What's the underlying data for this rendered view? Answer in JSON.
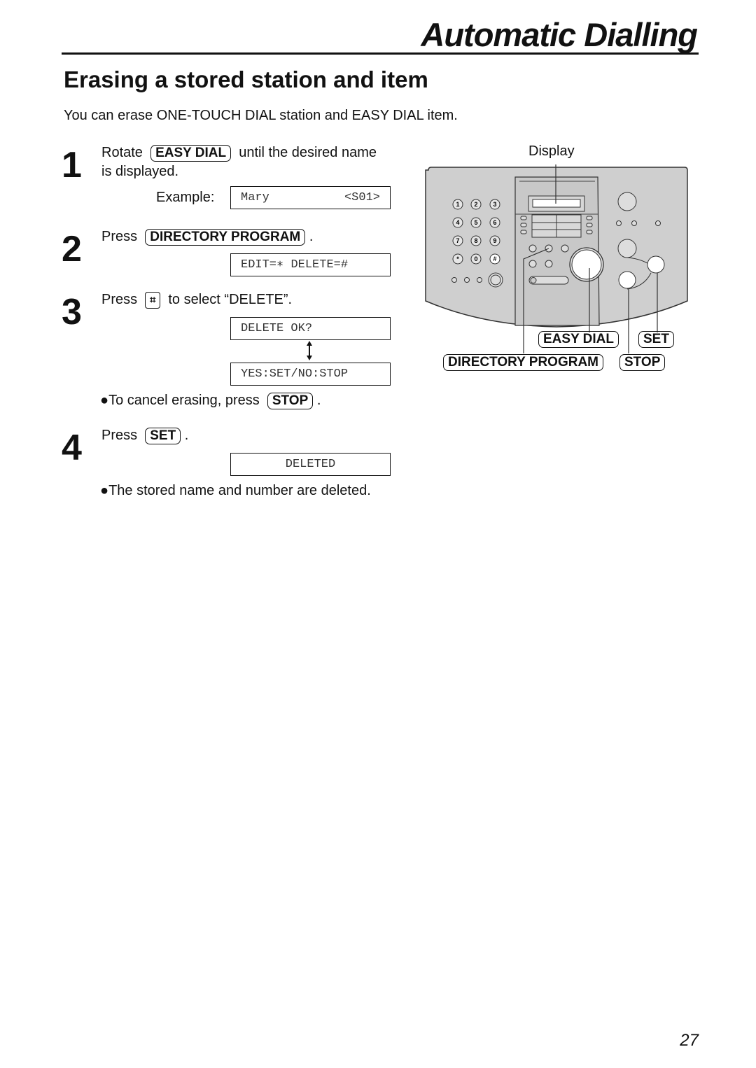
{
  "header": {
    "chapter_title": "Automatic Dialling"
  },
  "section": {
    "title": "Erasing a stored station and item",
    "intro": "You can erase ONE-TOUCH DIAL station and EASY DIAL item."
  },
  "steps": [
    {
      "number": "1",
      "prefix": "Rotate",
      "key": "EASY DIAL",
      "suffix_line1": "until the desired name",
      "suffix_line2": "is displayed.",
      "example_label": "Example:",
      "display_left": "Mary",
      "display_right": "<S01>"
    },
    {
      "number": "2",
      "prefix": "Press",
      "key": "DIRECTORY PROGRAM",
      "suffix": ".",
      "display": "EDIT=∗ DELETE=#"
    },
    {
      "number": "3",
      "prefix": "Press",
      "key_icon": "hash-key",
      "key_glyph": "⌗",
      "suffix": "to select “DELETE”.",
      "display_1": "DELETE OK?",
      "display_2": "YES:SET/NO:STOP",
      "note_prefix": "●To cancel erasing, press",
      "note_key": "STOP",
      "note_suffix": "."
    },
    {
      "number": "4",
      "prefix": "Press",
      "key": "SET",
      "suffix": ".",
      "display": "DELETED",
      "note": "●The stored name and number are deleted."
    }
  ],
  "diagram": {
    "display_label": "Display",
    "keypad": [
      "1",
      "2",
      "3",
      "4",
      "5",
      "6",
      "7",
      "8",
      "9",
      "∗",
      "0",
      "⌗"
    ],
    "callouts": {
      "easy_dial": "EASY DIAL",
      "set": "SET",
      "directory_program": "DIRECTORY PROGRAM",
      "stop": "STOP"
    }
  },
  "footer": {
    "page_number": "27"
  }
}
